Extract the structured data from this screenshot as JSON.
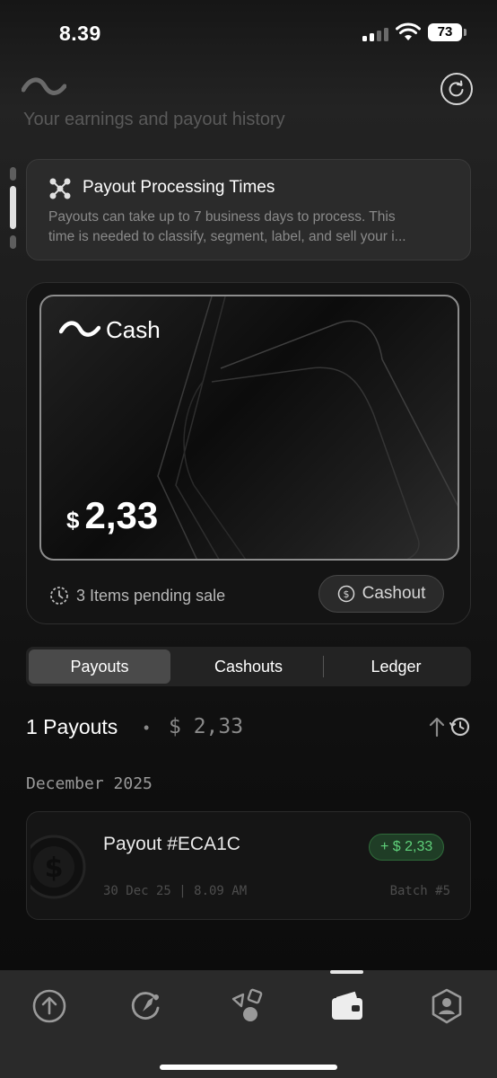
{
  "status_bar": {
    "time": "8.39",
    "battery": "73",
    "icons": [
      "signal-icon",
      "wifi-icon",
      "battery-icon"
    ]
  },
  "header": {
    "logo_icon": "wave-logo-icon",
    "refresh_icon": "refresh-icon",
    "subtitle": "Your earnings and payout history"
  },
  "info_card": {
    "icon": "nodes-icon",
    "title": "Payout Processing Times",
    "body_line1": "Payouts can take up to 7 business days to process. This",
    "body_line2": "time is needed to classify, segment, label, and sell your i..."
  },
  "wallet": {
    "card_label": "Cash",
    "currency": "$",
    "amount": "2,33",
    "pending_text": "3 Items pending sale",
    "cashout_label": "Cashout"
  },
  "tabs": {
    "items": [
      {
        "label": "Payouts",
        "active": true
      },
      {
        "label": "Cashouts",
        "active": false
      },
      {
        "label": "Ledger",
        "active": false
      }
    ]
  },
  "summary": {
    "title": "1 Payouts",
    "separator": "•",
    "total": "$ 2,33"
  },
  "groups": [
    {
      "month": "December 2025",
      "payouts": [
        {
          "name": "Payout #ECA1C",
          "amount": "+ $ 2,33",
          "date": "30 Dec 25 | 8.09 AM",
          "batch": "Batch #5"
        }
      ]
    }
  ],
  "colors": {
    "accent_green": "#5fd07a",
    "badge_bg": "#1f3d26",
    "card_border": "#8d8d8d"
  },
  "bottom_nav": {
    "items": [
      "upload-icon",
      "compass-icon",
      "shapes-icon",
      "wallet-icon",
      "profile-icon"
    ],
    "active": "wallet-icon"
  }
}
